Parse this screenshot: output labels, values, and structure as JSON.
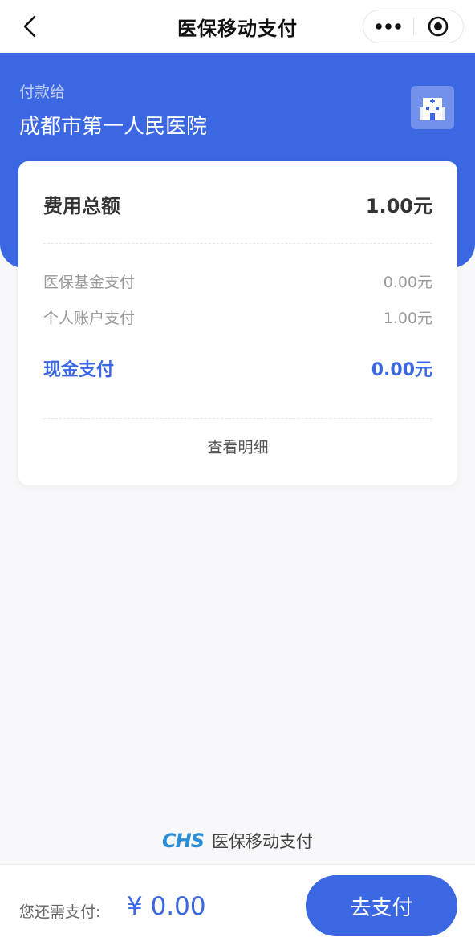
{
  "nav": {
    "title": "医保移动支付"
  },
  "payee": {
    "label": "付款给",
    "name": "成都市第一人民医院"
  },
  "summary": {
    "total_label": "费用总额",
    "total_value": "1.00元",
    "fund_label": "医保基金支付",
    "fund_value": "0.00元",
    "personal_label": "个人账户支付",
    "personal_value": "1.00元",
    "cash_label": "现金支付",
    "cash_value": "0.00元",
    "detail_link": "查看明细"
  },
  "brand": {
    "logo": "CHS",
    "text": "医保移动支付"
  },
  "bottom": {
    "remain_label": "您还需支付:",
    "remain_amount": "¥ 0.00",
    "pay_button": "去支付"
  },
  "colors": {
    "accent": "#3b67e3",
    "brand_logo": "#2a8fd6"
  },
  "icons": {
    "back": "chevron-left-icon",
    "more": "more-dots-icon",
    "close": "target-circle-icon",
    "hospital": "hospital-building-icon"
  }
}
